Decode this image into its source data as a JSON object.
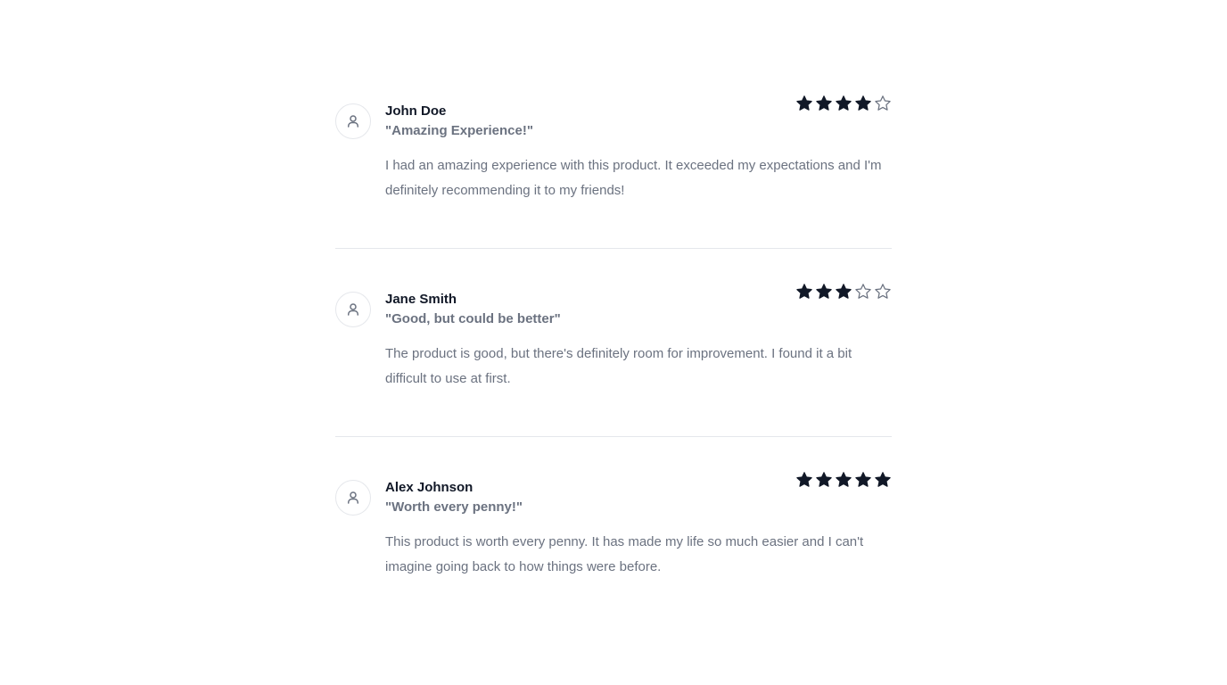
{
  "reviews": [
    {
      "name": "John Doe",
      "headline": "\"Amazing Experience!\"",
      "body": "I had an amazing experience with this product. It exceeded my expectations and I'm definitely recommending it to my friends!",
      "rating": 4,
      "max_rating": 5
    },
    {
      "name": "Jane Smith",
      "headline": "\"Good, but could be better\"",
      "body": "The product is good, but there's definitely room for improvement. I found it a bit difficult to use at first.",
      "rating": 3,
      "max_rating": 5
    },
    {
      "name": "Alex Johnson",
      "headline": "\"Worth every penny!\"",
      "body": "This product is worth every penny. It has made my life so much easier and I can't imagine going back to how things were before.",
      "rating": 5,
      "max_rating": 5
    }
  ],
  "icons": {
    "avatar": "user-icon",
    "star_filled": "star-filled-icon",
    "star_empty": "star-outline-icon"
  },
  "colors": {
    "star": "#111827",
    "divider": "#e5e7eb",
    "muted_text": "#6b7280"
  }
}
